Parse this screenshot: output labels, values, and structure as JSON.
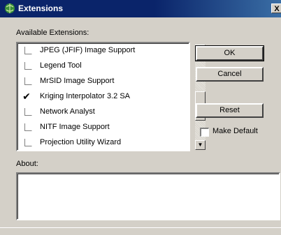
{
  "window": {
    "title": "Extensions",
    "close_glyph": "X",
    "icon": "globe-app-icon"
  },
  "labels": {
    "available": "Available Extensions:",
    "about": "About:"
  },
  "extensions": [
    {
      "label": "JPEG (JFIF) Image Support",
      "checked": false
    },
    {
      "label": "Legend Tool",
      "checked": false
    },
    {
      "label": "MrSID Image Support",
      "checked": false
    },
    {
      "label": "Kriging Interpolator 3.2 SA",
      "checked": true
    },
    {
      "label": "Network Analyst",
      "checked": false
    },
    {
      "label": "NITF Image Support",
      "checked": false
    },
    {
      "label": "Projection Utility Wizard",
      "checked": false
    }
  ],
  "check_glyph": "✔",
  "scroll": {
    "up": "▲",
    "down": "▼"
  },
  "buttons": {
    "ok": "OK",
    "cancel": "Cancel",
    "reset": "Reset"
  },
  "make_default": {
    "label": "Make Default",
    "checked": false
  },
  "about_text": ""
}
